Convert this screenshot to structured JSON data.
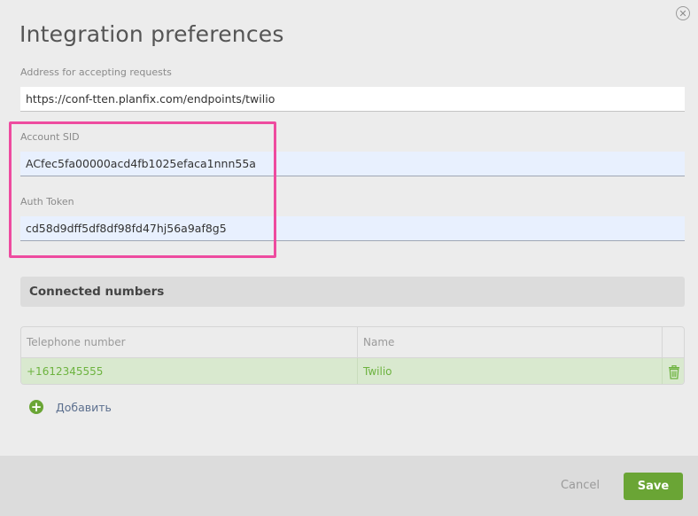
{
  "dialog": {
    "title": "Integration preferences",
    "close_icon": "close-circle-icon"
  },
  "fields": {
    "address": {
      "label": "Address for accepting requests",
      "value": "https://conf-tten.planfix.com/endpoints/twilio"
    },
    "account_sid": {
      "label": "Account SID",
      "value": "ACfec5fa00000acd4fb1025efaca1nnn55a"
    },
    "auth_token": {
      "label": "Auth Token",
      "value": "cd58d9dff5df8df98fd47hj56a9af8g5"
    }
  },
  "connected_numbers": {
    "header": "Connected numbers",
    "columns": [
      "Telephone number",
      "Name"
    ],
    "rows": [
      {
        "phone": "+1612345555",
        "name": "Twilio",
        "delete_icon": "trash-icon"
      }
    ],
    "add_label": "Добавить",
    "add_icon": "plus-circle-icon"
  },
  "footer": {
    "cancel_label": "Cancel",
    "save_label": "Save"
  },
  "colors": {
    "accent_green": "#6aa535",
    "highlight_pink": "#ee4b9f",
    "row_green": "#d9e9cf",
    "link_blue": "#5c6f8e"
  }
}
